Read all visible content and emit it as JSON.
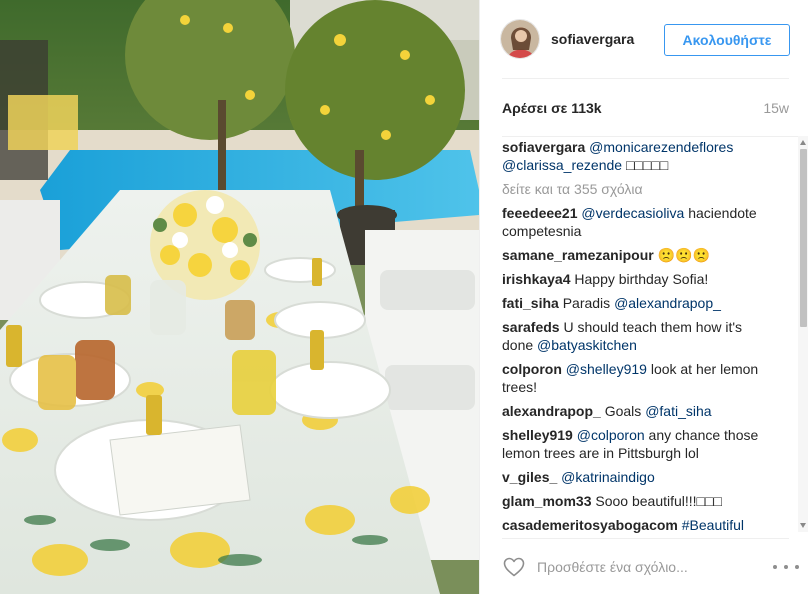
{
  "post": {
    "username": "sofiavergara",
    "follow_label": "Ακολουθήστε",
    "likes": "Αρέσει σε 113k",
    "time_ago": "15w",
    "caption": {
      "user": "sofiavergara",
      "mention1": "@monicarezendeflores",
      "mention2": "@clarissa_rezende",
      "emojis": "□□□□□"
    },
    "view_all_comments": "δείτε και τα 355 σχόλια"
  },
  "comments": [
    {
      "user": "feeedeee21",
      "mention": "@verdecasioliva",
      "text": " haciendote competesnia"
    },
    {
      "user": "samane_ramezanipour",
      "mention": "",
      "text": " 🙁🙁🙁"
    },
    {
      "user": "irishkaya4",
      "mention": "",
      "text": " Happy birthday Sofia!"
    },
    {
      "user": "fati_siha",
      "mention": "",
      "text": " Paradis ",
      "mention_after": "@alexandrapop_"
    },
    {
      "user": "sarafeds",
      "mention": "",
      "text": " U should teach them how it's done ",
      "mention_after": "@batyaskitchen"
    },
    {
      "user": "colporon",
      "mention": "@shelley919",
      "text": " look at her lemon trees!"
    },
    {
      "user": "alexandrapop_",
      "mention": "",
      "text": " Goals ",
      "mention_after": "@fati_siha"
    },
    {
      "user": "shelley919",
      "mention": "@colporon",
      "text": " any chance those lemon trees are in Pittsburgh lol"
    },
    {
      "user": "v_giles_",
      "mention": "@katrinaindigo",
      "text": ""
    },
    {
      "user": "glam_mom33",
      "mention": "",
      "text": " Sooo beautiful!!!□□□"
    },
    {
      "user": "casademeritosyabogacom",
      "mention": "#Beautiful",
      "text": ""
    }
  ],
  "composer": {
    "placeholder": "Προσθέστε ένα σχόλιο..."
  },
  "icons": {
    "like": "heart-outline-icon",
    "more": "more-options-icon"
  },
  "colors": {
    "accent": "#3897f0",
    "link": "#003569",
    "muted": "#999999"
  }
}
